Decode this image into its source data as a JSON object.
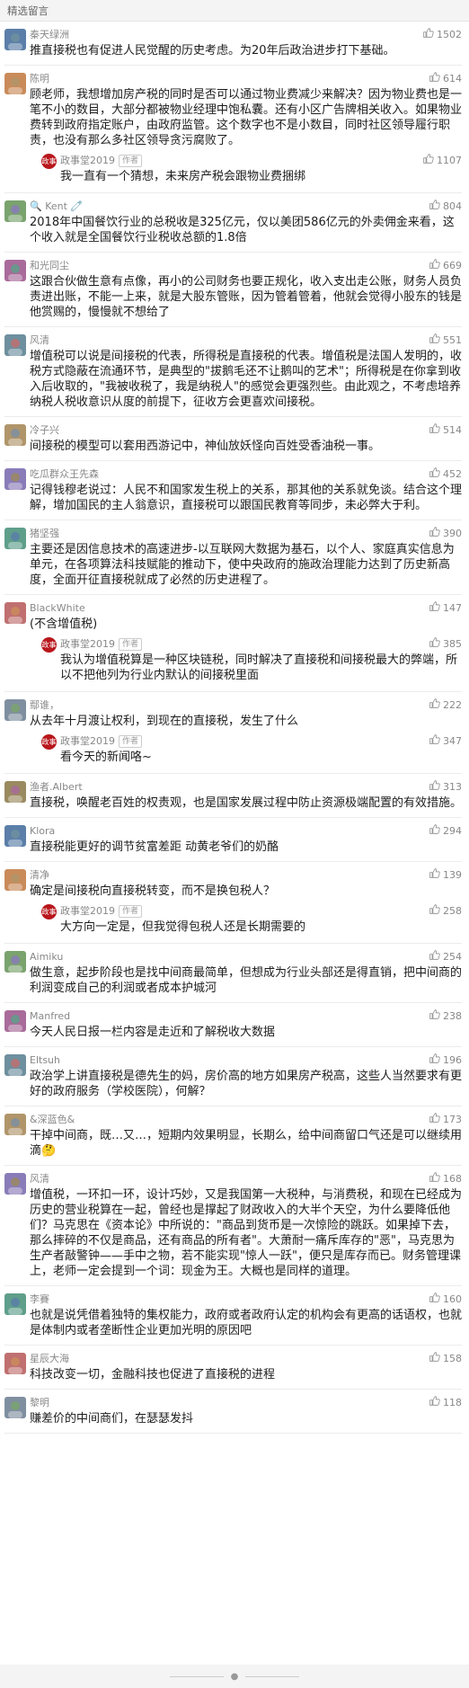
{
  "header": {
    "title": "精选留言"
  },
  "icons": {
    "like": "thumbs-up-icon"
  },
  "colors": {
    "author_avatar": "#b8171c",
    "meta_text": "#888888"
  },
  "author": {
    "name": "政事堂2019",
    "badge": "作者",
    "avatar_text": "政事堂"
  },
  "comments": [
    {
      "nick": "秦天绿洲",
      "likes": "1502",
      "text": "推直接税也有促进人民觉醒的历史考虑。为20年后政治进步打下基础。"
    },
    {
      "nick": "陈明",
      "likes": "614",
      "text": "顾老师，我想增加房产税的同时是否可以通过物业费减少来解决？因为物业费也是一笔不小的数目，大部分都被物业经理中饱私囊。还有小区广告牌相关收入。如果物业费转到政府指定账户，由政府监管。这个数字也不是小数目，同时社区领导履行职责，也没有那么多社区领导贪污腐败了。",
      "reply": {
        "likes": "1107",
        "text": "我一直有一个猜想，未来房产税会跟物业费捆绑"
      }
    },
    {
      "nick": "🔍 Kent 🧷",
      "likes": "804",
      "text": "2018年中国餐饮行业的总税收是325亿元，仅以美团586亿元的外卖佣金来看，这个收入就是全国餐饮行业税收总额的1.8倍"
    },
    {
      "nick": "和光同尘",
      "likes": "669",
      "text": "这跟合伙做生意有点像，再小的公司财务也要正规化，收入支出走公账，财务人员负责进出账，不能一上来，就是大股东管账，因为管着管着，他就会觉得小股东的钱是他赏赐的，慢慢就不想给了"
    },
    {
      "nick": "风清",
      "likes": "551",
      "text": "增值税可以说是间接税的代表，所得税是直接税的代表。增值税是法国人发明的，收税方式隐蔽在流通环节，是典型的\"拔鹅毛还不让鹅叫的艺术\"；所得税是在你拿到收入后收取的，\"我被收税了，我是纳税人\"的感觉会更强烈些。由此观之，不考虑培养纳税人税收意识从度的前提下，征收方会更喜欢间接税。"
    },
    {
      "nick": "冷子兴",
      "likes": "514",
      "text": "间接税的模型可以套用西游记中，神仙放妖怪向百姓受香油税一事。"
    },
    {
      "nick": "吃瓜群众王先森",
      "likes": "452",
      "text": "记得钱穆老说过：人民不和国家发生税上的关系，那其他的关系就免谈。结合这个理解，增加国民的主人翁意识，直接税可以跟国民教育等同步，未必弊大于利。"
    },
    {
      "nick": "猪坚强",
      "likes": "390",
      "text": "主要还是因信息技术的高速进步-以互联网大数据为基石，以个人、家庭真实信息为单元，在各项算法科技赋能的推动下，使中央政府的施政治理能力达到了历史新高度，全面开征直接税就成了必然的历史进程了。"
    },
    {
      "nick": "BlackWhite",
      "likes": "147",
      "text": "(不含增值税)",
      "reply": {
        "likes": "385",
        "text": "我认为增值税算是一种区块链税，同时解决了直接税和间接税最大的弊端，所以不把他列为行业内默认的间接税里面"
      }
    },
    {
      "nick": "鄢谁，",
      "likes": "222",
      "text": "从去年十月渡让权利，到现在的直接税，发生了什么",
      "reply": {
        "likes": "347",
        "text": "看今天的新闻咯~"
      }
    },
    {
      "nick": "渔者.Albert",
      "likes": "313",
      "text": "直接税，唤醒老百姓的权责观，也是国家发展过程中防止资源极端配置的有效措施。"
    },
    {
      "nick": "Klora",
      "likes": "294",
      "text": "直接税能更好的调节贫富差距 动黄老爷们的奶酪"
    },
    {
      "nick": "清净",
      "likes": "139",
      "text": "确定是间接税向直接税转变，而不是换包税人？",
      "reply": {
        "likes": "258",
        "text": "大方向一定是，但我觉得包税人还是长期需要的"
      }
    },
    {
      "nick": "Aimiku",
      "likes": "254",
      "text": "做生意，起步阶段也是找中间商最简单，但想成为行业头部还是得直销，把中间商的利润变成自己的利润或者成本护城河"
    },
    {
      "nick": "Manfred",
      "likes": "238",
      "text": "今天人民日报一栏内容是走近和了解税收大数据"
    },
    {
      "nick": "Eltsuh",
      "likes": "196",
      "text": "政治学上讲直接税是德先生的妈，房价高的地方如果房产税高，这些人当然要求有更好的政府服务（学校医院），何解？"
    },
    {
      "nick": "&深蓝色&",
      "likes": "173",
      "text": "干掉中间商，既…又…，短期内效果明显，长期么，给中间商留口气还是可以继续用滴🤔"
    },
    {
      "nick": "风清",
      "likes": "168",
      "text": "增值税，一环扣一环，设计巧妙，又是我国第一大税种，与消费税，和现在已经成为历史的营业税算在一起，曾经也是撑起了财政收入的大半个天空，为什么要降低他们？马克思在《资本论》中所说的：\"商品到货币是一次惊险的跳跃。如果掉下去，那么摔碎的不仅是商品，还有商品的所有者\"。大萧耐一痛斥库存的\"恶\"，马克思为生产者敲警钟——手中之物，若不能实现\"惊人一跃\"，便只是库存而已。财务管理课上，老师一定会提到一个词：现金为王。大概也是同样的道理。"
    },
    {
      "nick": "李賽",
      "likes": "160",
      "text": "也就是说凭借着独特的集权能力，政府或者政府认定的机构会有更高的话语权，也就是体制内或者垄断性企业更加光明的原因吧"
    },
    {
      "nick": "星辰大海",
      "likes": "158",
      "text": "科技改变一切，金融科技也促进了直接税的进程"
    },
    {
      "nick": "黎明",
      "likes": "118",
      "text": "赚差价的中间商们，在瑟瑟发抖"
    }
  ]
}
